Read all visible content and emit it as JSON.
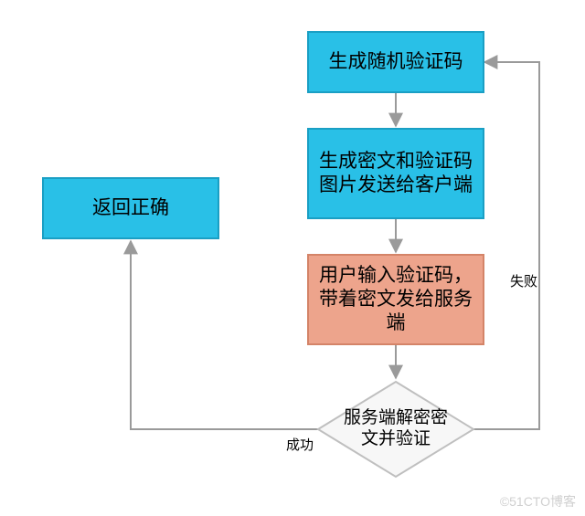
{
  "chart_data": {
    "type": "flowchart",
    "nodes": [
      {
        "id": "n1",
        "label": "生成随机验证码",
        "shape": "rect",
        "fill": "#29c0e7",
        "border": "#1a9fc4"
      },
      {
        "id": "n2",
        "label": "生成密文和验证码图片发送给客户端",
        "shape": "rect",
        "fill": "#29c0e7",
        "border": "#1a9fc4"
      },
      {
        "id": "n3",
        "label": "用户输入验证码，带着密文发给服务端",
        "shape": "rect",
        "fill": "#eda48c",
        "border": "#d48468"
      },
      {
        "id": "n4",
        "label": "服务端解密密文并验证",
        "shape": "diamond",
        "fill": "#f7f7f7",
        "border": "#bfbfbf"
      },
      {
        "id": "n5",
        "label": "返回正确",
        "shape": "rect",
        "fill": "#29c0e7",
        "border": "#1a9fc4"
      }
    ],
    "edges": [
      {
        "from": "n1",
        "to": "n2",
        "label": ""
      },
      {
        "from": "n2",
        "to": "n3",
        "label": ""
      },
      {
        "from": "n3",
        "to": "n4",
        "label": ""
      },
      {
        "from": "n4",
        "to": "n5",
        "label": "成功"
      },
      {
        "from": "n4",
        "to": "n1",
        "label": "失败"
      }
    ]
  },
  "nodes": {
    "n1": "生成随机验证码",
    "n2": "生成密文和验证码图片发送给客户端",
    "n3": "用户输入验证码，带着密文发给服务端",
    "n4": "服务端解密密文并验证",
    "n5": "返回正确"
  },
  "edges": {
    "success": "成功",
    "failure": "失败"
  },
  "watermark": "©51CTO博客"
}
